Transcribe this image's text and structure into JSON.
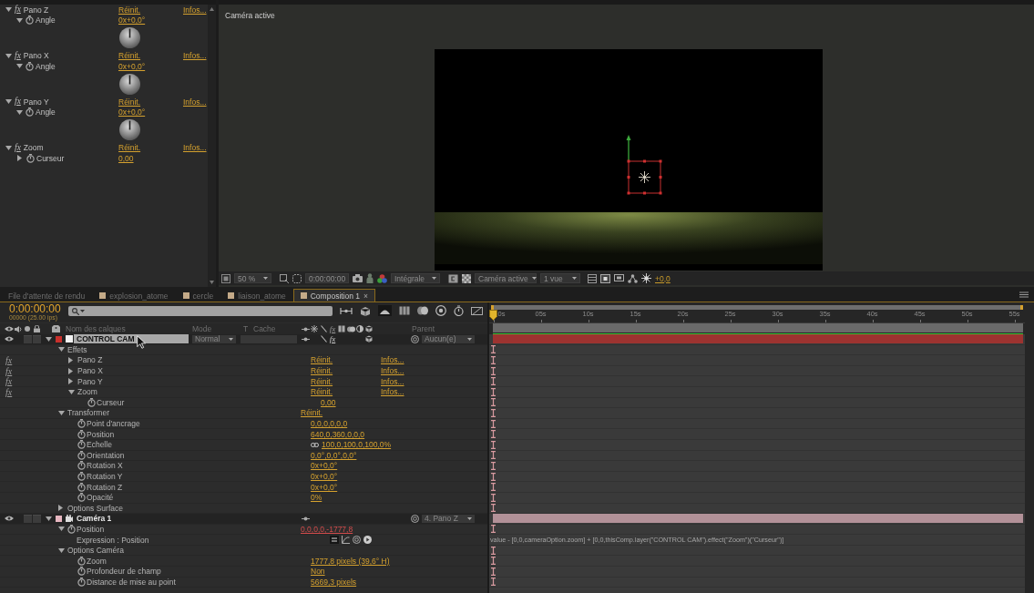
{
  "effect_controls": {
    "effects": [
      {
        "name": "Pano Z",
        "badge": "fx",
        "expanded": true,
        "reset": "Réinit.",
        "about": "Infos...",
        "property": {
          "name": "Angle",
          "kind": "angle",
          "expanded": true,
          "value": "0x+0,0°"
        }
      },
      {
        "name": "Pano X",
        "badge": "fx",
        "expanded": true,
        "reset": "Réinit.",
        "about": "Infos...",
        "property": {
          "name": "Angle",
          "kind": "angle",
          "expanded": true,
          "value": "0x+0,0°"
        }
      },
      {
        "name": "Pano Y",
        "badge": "fx",
        "expanded": true,
        "reset": "Réinit.",
        "about": "Infos...",
        "property": {
          "name": "Angle",
          "kind": "angle",
          "expanded": true,
          "value": "0x+0,0°"
        }
      },
      {
        "name": "Zoom",
        "badge": "fx",
        "expanded": true,
        "reset": "Réinit.",
        "about": "Infos...",
        "property": {
          "name": "Curseur",
          "expanded": false,
          "value": "0,00"
        }
      }
    ]
  },
  "viewer": {
    "camera_label": "Caméra active",
    "toolbar": {
      "magnification": "50 %",
      "time": "0:00:00:00",
      "resolution": "Intégrale",
      "view": "Caméra active",
      "layout": "1 vue",
      "exposure": "+0,0"
    }
  },
  "panel_tabs": [
    {
      "label": "File d'attente de rendu",
      "kind": "queue",
      "selected": false
    },
    {
      "label": "explosion_atome",
      "kind": "composition",
      "selected": false
    },
    {
      "label": "cercle",
      "kind": "composition",
      "selected": false
    },
    {
      "label": "liaison_atome",
      "kind": "composition",
      "selected": false
    },
    {
      "label": "Composition 1",
      "kind": "composition",
      "selected": true,
      "close": "×"
    }
  ],
  "timeline": {
    "current_time": "0:00:00:00",
    "frame_info": "00000 (25.00 ips)",
    "columns": {
      "layer_name": "Nom des calques",
      "mode": "Mode",
      "track_matte": "T",
      "matte": "Cache",
      "switches": [
        {
          "kind": "shy"
        },
        {
          "kind": "collapse"
        },
        {
          "kind": "quality"
        },
        {
          "kind": "effects",
          "label": "fx"
        },
        {
          "kind": "blend"
        },
        {
          "kind": "blur"
        },
        {
          "kind": "adjustment"
        },
        {
          "kind": "depth"
        }
      ],
      "parent": "Parent"
    },
    "ruler": [
      "0s",
      "05s",
      "10s",
      "15s",
      "20s",
      "25s",
      "30s",
      "35s",
      "40s",
      "45s",
      "50s",
      "55s"
    ],
    "layers": [
      {
        "name": "CONTROL CAM",
        "kind": "null",
        "color": "#c8302c",
        "visible": true,
        "expanded": true,
        "renaming": true,
        "mode": "Normal",
        "switches": [
          {
            "kind": "shy"
          },
          {
            "kind": "quality"
          },
          {
            "kind": "effects",
            "label": "fx",
            "on": true
          },
          {
            "kind": "depth"
          }
        ],
        "parent": "Aucun(e)",
        "children": [
          {
            "name": "Effets",
            "kind": "group",
            "expanded": true,
            "children": [
              {
                "name": "Pano Z",
                "kind": "effect",
                "badge": "fx",
                "expanded": false,
                "value": "Réinit.",
                "about": "Infos..."
              },
              {
                "name": "Pano X",
                "kind": "effect",
                "badge": "fx",
                "expanded": false,
                "value": "Réinit.",
                "about": "Infos..."
              },
              {
                "name": "Pano Y",
                "kind": "effect",
                "badge": "fx",
                "expanded": false,
                "value": "Réinit.",
                "about": "Infos..."
              },
              {
                "name": "Zoom",
                "kind": "effect",
                "badge": "fx",
                "expanded": true,
                "value": "Réinit.",
                "about": "Infos...",
                "children": [
                  {
                    "name": "Curseur",
                    "kind": "property",
                    "value": "0,00"
                  }
                ]
              }
            ]
          },
          {
            "name": "Transformer",
            "kind": "group",
            "expanded": true,
            "value": "Réinit.",
            "children": [
              {
                "name": "Point d'ancrage",
                "kind": "property",
                "value": "0,0,0,0,0,0"
              },
              {
                "name": "Position",
                "kind": "property",
                "value": "640,0,360,0,0,0"
              },
              {
                "name": "Echelle",
                "kind": "property",
                "linked": true,
                "value": "100,0,100,0,100,0%"
              },
              {
                "name": "Orientation",
                "kind": "property",
                "value": "0,0°,0,0°,0,0°"
              },
              {
                "name": "Rotation X",
                "kind": "property",
                "value": "0x+0,0°"
              },
              {
                "name": "Rotation Y",
                "kind": "property",
                "value": "0x+0,0°"
              },
              {
                "name": "Rotation Z",
                "kind": "property",
                "value": "0x+0,0°"
              },
              {
                "name": "Opacité",
                "kind": "property",
                "value": "0%"
              }
            ]
          },
          {
            "name": "Options Surface",
            "kind": "group",
            "expanded": false
          }
        ]
      },
      {
        "name": "Caméra 1",
        "kind": "camera",
        "color": "#e6b6c0",
        "visible": true,
        "expanded": true,
        "renaming": false,
        "switches": [
          {
            "kind": "shy"
          }
        ],
        "parent": "4. Pano Z",
        "children": [
          {
            "name": "Position",
            "kind": "property",
            "expanded": true,
            "expression": true,
            "value": "0,0,0,0,-1777,8",
            "children": [
              {
                "name": "Expression : Position",
                "kind": "expression",
                "code": "value - [0,0,cameraOption.zoom] + [0,0,thisComp.layer(\"CONTROL CAM\").effect(\"Zoom\")(\"Curseur\")]"
              }
            ]
          },
          {
            "name": "Options Caméra",
            "kind": "group",
            "expanded": true,
            "children": [
              {
                "name": "Zoom",
                "kind": "property",
                "value": "1777,8 pixels (39,6° H)"
              },
              {
                "name": "Profondeur de champ",
                "kind": "property",
                "value": "Non"
              },
              {
                "name": "Distance de mise au point",
                "kind": "property",
                "value": "5669,3 pixels"
              }
            ]
          }
        ]
      }
    ]
  }
}
